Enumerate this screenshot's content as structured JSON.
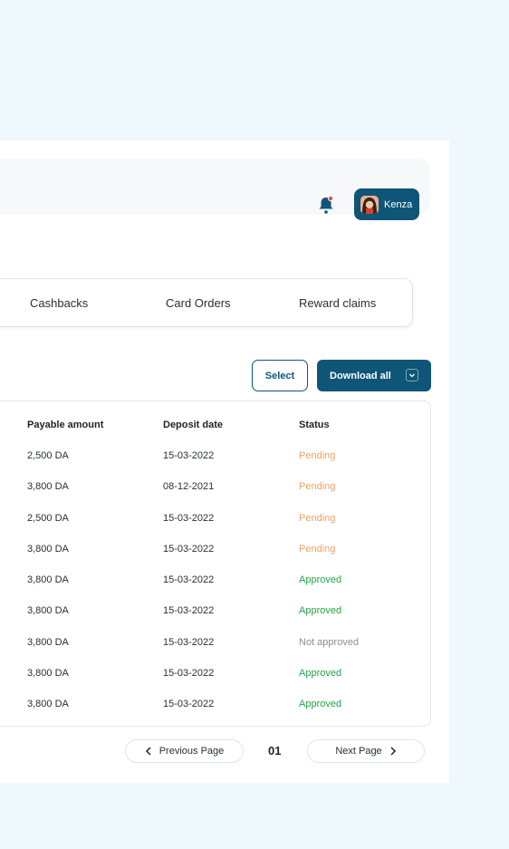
{
  "header": {
    "user_name": "Kenza"
  },
  "tabs": [
    "Cashbacks",
    "Card Orders",
    "Reward claims"
  ],
  "actions": {
    "select_label": "Select",
    "download_label": "Download all"
  },
  "table": {
    "columns": [
      "Payable amount",
      "Deposit date",
      "Status"
    ],
    "rows": [
      {
        "amount": "2,500 DA",
        "date": "15-03-2022",
        "status": "Pending"
      },
      {
        "amount": "3,800 DA",
        "date": "08-12-2021",
        "status": "Pending"
      },
      {
        "amount": "2,500 DA",
        "date": "15-03-2022",
        "status": "Pending"
      },
      {
        "amount": "3,800 DA",
        "date": "15-03-2022",
        "status": "Pending"
      },
      {
        "amount": "3,800 DA",
        "date": "15-03-2022",
        "status": "Approved"
      },
      {
        "amount": "3,800 DA",
        "date": "15-03-2022",
        "status": "Approved"
      },
      {
        "amount": "3,800 DA",
        "date": "15-03-2022",
        "status": "Not approved"
      },
      {
        "amount": "3,800 DA",
        "date": "15-03-2022",
        "status": "Approved"
      },
      {
        "amount": "3,800 DA",
        "date": "15-03-2022",
        "status": "Approved"
      }
    ]
  },
  "status_colors": {
    "Pending": "#f0a35e",
    "Approved": "#22a447",
    "Not approved": "#8a8f94"
  },
  "pagination": {
    "previous_label": "Previous Page",
    "next_label": "Next Page",
    "current_page": "01"
  },
  "colors": {
    "brand": "#0e5577",
    "background": "#eef8fd"
  },
  "icons": [
    "bell-icon",
    "chevron-down-icon",
    "chevron-left-icon",
    "chevron-right-icon"
  ]
}
